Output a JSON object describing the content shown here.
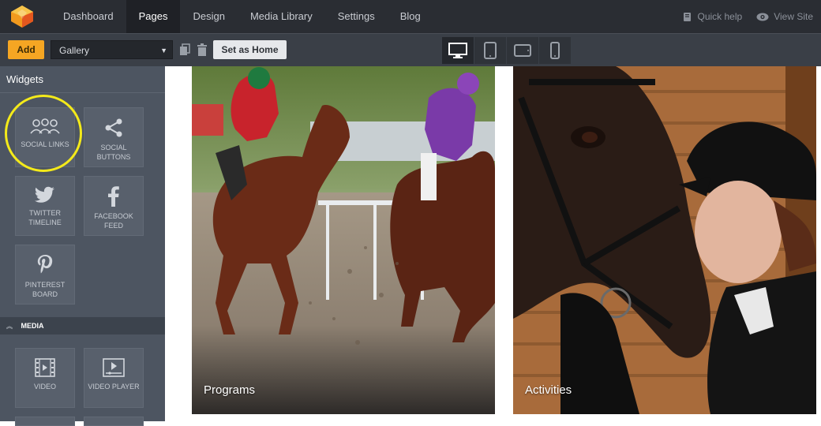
{
  "nav": {
    "items": [
      {
        "label": "Dashboard"
      },
      {
        "label": "Pages"
      },
      {
        "label": "Design"
      },
      {
        "label": "Media Library"
      },
      {
        "label": "Settings"
      },
      {
        "label": "Blog"
      }
    ],
    "active": "Pages",
    "quick_help": "Quick help",
    "view_site": "View Site"
  },
  "toolbar": {
    "add_label": "Add",
    "page_select_value": "Gallery",
    "set_home_label": "Set as Home",
    "devices": [
      "desktop-icon",
      "tablet-icon",
      "tablet-landscape-icon",
      "mobile-icon"
    ],
    "active_device": "desktop-icon"
  },
  "sidebar": {
    "title": "Widgets",
    "widgets": [
      {
        "label": "SOCIAL LINKS",
        "icon": "social-links-icon"
      },
      {
        "label": "SOCIAL BUTTONS",
        "icon": "share-icon"
      },
      {
        "label": "TWITTER TIMELINE",
        "icon": "twitter-icon"
      },
      {
        "label": "FACEBOOK FEED",
        "icon": "facebook-icon"
      },
      {
        "label": "PINTEREST BOARD",
        "icon": "pinterest-icon"
      }
    ],
    "media_section": {
      "title": "MEDIA",
      "widgets": [
        {
          "label": "VIDEO",
          "icon": "video-icon"
        },
        {
          "label": "VIDEO PLAYER",
          "icon": "video-player-icon"
        }
      ]
    }
  },
  "gallery": {
    "cards": [
      {
        "caption": "Programs"
      },
      {
        "caption": "Activities"
      }
    ]
  },
  "colors": {
    "topbar": "#2a2d33",
    "toolbar": "#3a3f47",
    "sidebar": "#4d5561",
    "accent_add": "#f5a623",
    "highlight_ring": "#f4ea1a"
  }
}
